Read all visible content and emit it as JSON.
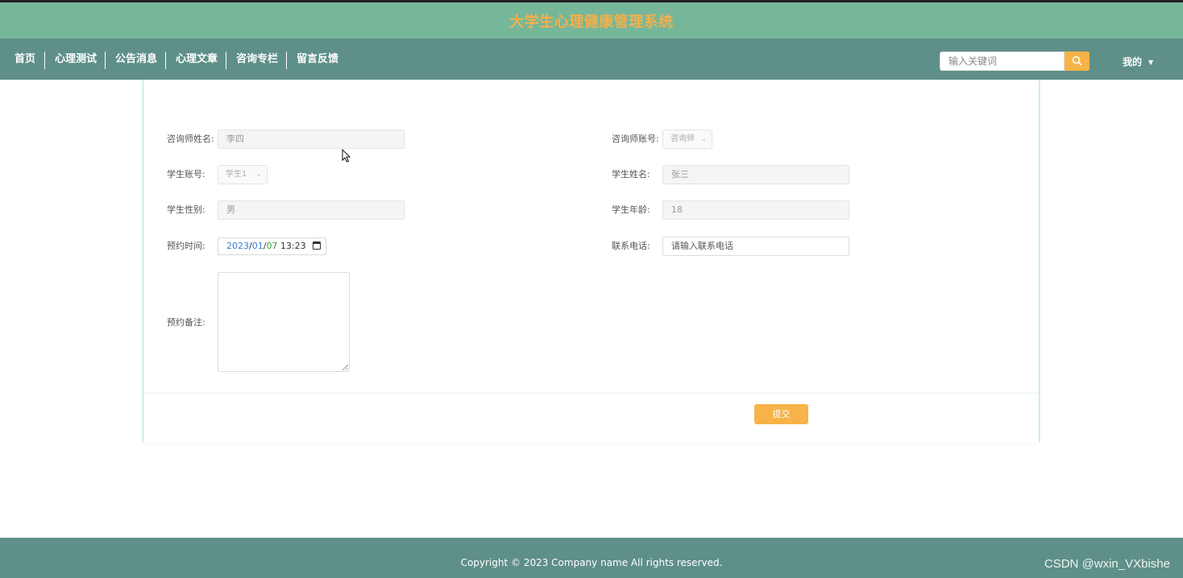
{
  "header": {
    "site_title": "大学生心理健康管理系统"
  },
  "nav": {
    "items": [
      {
        "label": "首页"
      },
      {
        "label": "心理测试"
      },
      {
        "label": "公告消息"
      },
      {
        "label": "心理文章"
      },
      {
        "label": "咨询专栏"
      },
      {
        "label": "留言反馈"
      }
    ],
    "search_placeholder": "输入关键词",
    "user_menu": "我的"
  },
  "form": {
    "counselor_name": {
      "label": "咨询师姓名:",
      "value": "李四"
    },
    "counselor_account": {
      "label": "咨询师账号:",
      "value": "咨询师"
    },
    "student_account": {
      "label": "学生账号:",
      "value": "学生1"
    },
    "student_name": {
      "label": "学生姓名:",
      "value": "张三"
    },
    "student_gender": {
      "label": "学生性别:",
      "value": "男"
    },
    "student_age": {
      "label": "学生年龄:",
      "value": "18"
    },
    "appointment_time": {
      "label": "预约时间:",
      "year": "2023",
      "month": "01",
      "day": "07",
      "time": "13:23"
    },
    "phone": {
      "label": "联系电话:",
      "placeholder": "请输入联系电话"
    },
    "remarks": {
      "label": "预约备注:"
    },
    "submit_label": "提交"
  },
  "footer": {
    "copyright": "Copyright © 2023 Company name All rights reserved.",
    "watermark": "CSDN @wxin_VXbishe"
  },
  "colors": {
    "topbar": "#76b79a",
    "navbar": "#5e8f88",
    "accent": "#f7b347",
    "title": "#f4b04a"
  }
}
